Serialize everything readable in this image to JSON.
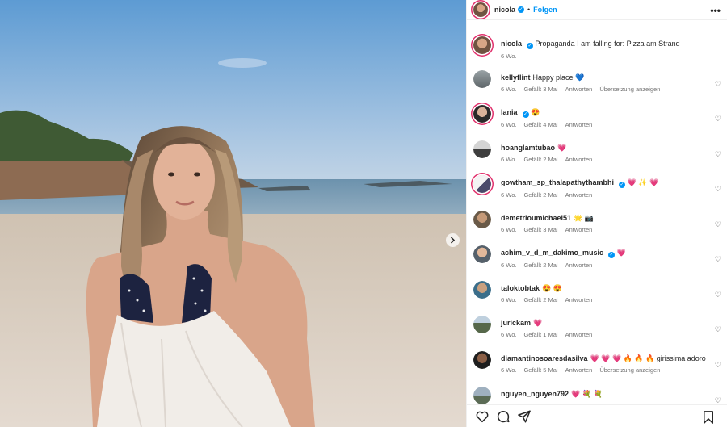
{
  "post": {
    "author": "nicola",
    "follow_label": "Folgen",
    "separator": "•",
    "more_label": "•••"
  },
  "caption": {
    "author": "nicola",
    "text": "Propaganda I am falling for: Pizza am Strand",
    "time": "6 Wo."
  },
  "comments": [
    {
      "user": "kellyflint",
      "text": "Happy place 💙",
      "time": "6 Wo.",
      "likes": "Gefällt 3 Mal",
      "reply": "Antworten",
      "translate": "Übersetzung anzeigen",
      "verified": false
    },
    {
      "user": "lania",
      "text": "😍",
      "time": "6 Wo.",
      "likes": "Gefällt 4 Mal",
      "reply": "Antworten",
      "translate": "",
      "verified": true
    },
    {
      "user": "hoanglamtubao",
      "text": "💗",
      "time": "6 Wo.",
      "likes": "Gefällt 2 Mal",
      "reply": "Antworten",
      "translate": "",
      "verified": false
    },
    {
      "user": "gowtham_sp_thalapathythambhi",
      "text": "💗 ✨ 💗",
      "time": "6 Wo.",
      "likes": "Gefällt 2 Mal",
      "reply": "Antworten",
      "translate": "",
      "verified": true
    },
    {
      "user": "demetrioumichael51",
      "text": "🌟 📷",
      "time": "6 Wo.",
      "likes": "Gefällt 3 Mal",
      "reply": "Antworten",
      "translate": "",
      "verified": false
    },
    {
      "user": "achim_v_d_m_dakimo_music",
      "text": "💗",
      "time": "6 Wo.",
      "likes": "Gefällt 2 Mal",
      "reply": "Antworten",
      "translate": "",
      "verified": true
    },
    {
      "user": "taloktobtak",
      "text": "😍 😍",
      "time": "6 Wo.",
      "likes": "Gefällt 2 Mal",
      "reply": "Antworten",
      "translate": "",
      "verified": false
    },
    {
      "user": "jurickam",
      "text": "💗",
      "time": "6 Wo.",
      "likes": "Gefällt 1 Mal",
      "reply": "Antworten",
      "translate": "",
      "verified": false
    },
    {
      "user": "diamantinosoaresdasilva",
      "text": "💗 💗 💗 🔥 🔥 🔥 girissima adoro",
      "time": "6 Wo.",
      "likes": "Gefällt 5 Mal",
      "reply": "Antworten",
      "translate": "Übersetzung anzeigen",
      "verified": false
    },
    {
      "user": "nguyen_nguyen792",
      "text": "💗 💐 💐",
      "time": "",
      "likes": "",
      "reply": "",
      "translate": "",
      "verified": false
    }
  ],
  "colors": {
    "accent": "#0095f6",
    "story_ring": "#e1306c",
    "muted_text": "#737373"
  },
  "icons": {
    "like": "heart-icon",
    "comment": "comment-icon",
    "share": "share-icon",
    "save": "bookmark-icon",
    "next": "chevron-right-icon",
    "verified": "verified-badge-icon"
  }
}
